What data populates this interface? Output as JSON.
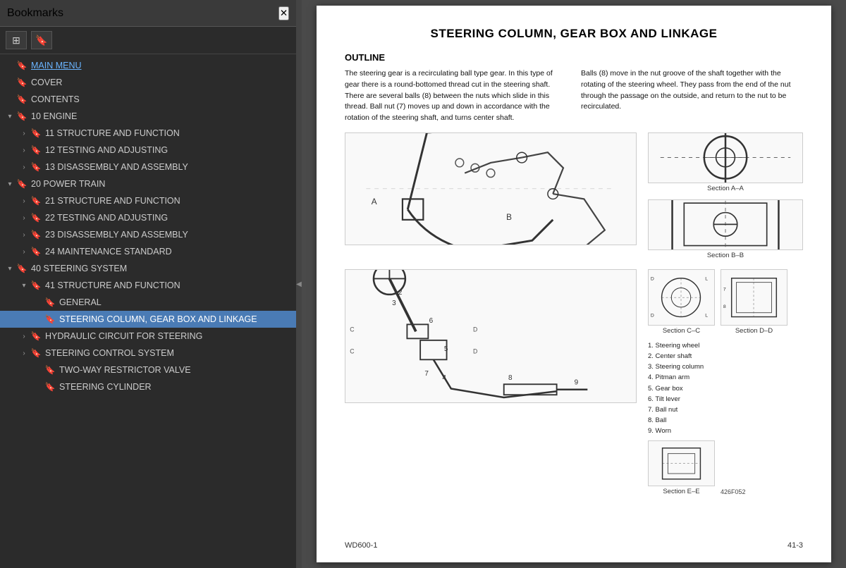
{
  "sidebar": {
    "title": "Bookmarks",
    "items": [
      {
        "id": "main-menu",
        "label": "MAIN MENU",
        "indent": 0,
        "type": "link",
        "expand": "none",
        "bookmark": true
      },
      {
        "id": "cover",
        "label": "COVER",
        "indent": 0,
        "type": "normal",
        "expand": "none",
        "bookmark": true
      },
      {
        "id": "contents",
        "label": "CONTENTS",
        "indent": 0,
        "type": "normal",
        "expand": "none",
        "bookmark": true
      },
      {
        "id": "10-engine",
        "label": "10 ENGINE",
        "indent": 0,
        "type": "normal",
        "expand": "open",
        "bookmark": true
      },
      {
        "id": "11-struct",
        "label": "11 STRUCTURE AND FUNCTION",
        "indent": 1,
        "type": "normal",
        "expand": "closed",
        "bookmark": true
      },
      {
        "id": "12-test",
        "label": "12 TESTING AND ADJUSTING",
        "indent": 1,
        "type": "normal",
        "expand": "closed",
        "bookmark": true
      },
      {
        "id": "13-disasm",
        "label": "13 DISASSEMBLY AND ASSEMBLY",
        "indent": 1,
        "type": "normal",
        "expand": "closed",
        "bookmark": true
      },
      {
        "id": "20-power",
        "label": "20 POWER TRAIN",
        "indent": 0,
        "type": "normal",
        "expand": "open",
        "bookmark": true
      },
      {
        "id": "21-struct",
        "label": "21 STRUCTURE AND FUNCTION",
        "indent": 1,
        "type": "normal",
        "expand": "closed",
        "bookmark": true
      },
      {
        "id": "22-test",
        "label": "22 TESTING AND ADJUSTING",
        "indent": 1,
        "type": "normal",
        "expand": "closed",
        "bookmark": true
      },
      {
        "id": "23-disasm",
        "label": "23 DISASSEMBLY AND ASSEMBLY",
        "indent": 1,
        "type": "normal",
        "expand": "closed",
        "bookmark": true
      },
      {
        "id": "24-maint",
        "label": "24 MAINTENANCE STANDARD",
        "indent": 1,
        "type": "normal",
        "expand": "closed",
        "bookmark": true
      },
      {
        "id": "40-steering",
        "label": "40 STEERING SYSTEM",
        "indent": 0,
        "type": "normal",
        "expand": "open",
        "bookmark": true
      },
      {
        "id": "41-struct",
        "label": "41 STRUCTURE AND FUNCTION",
        "indent": 1,
        "type": "normal",
        "expand": "open",
        "bookmark": true
      },
      {
        "id": "general",
        "label": "GENERAL",
        "indent": 2,
        "type": "normal",
        "expand": "none",
        "bookmark": true
      },
      {
        "id": "steering-col",
        "label": "STEERING COLUMN, GEAR BOX AND LINKAGE",
        "indent": 2,
        "type": "normal",
        "expand": "none",
        "bookmark": true,
        "selected": true
      },
      {
        "id": "hydraulic",
        "label": "HYDRAULIC CIRCUIT FOR STEERING",
        "indent": 1,
        "type": "normal",
        "expand": "closed",
        "bookmark": true
      },
      {
        "id": "steering-ctrl",
        "label": "STEERING CONTROL SYSTEM",
        "indent": 1,
        "type": "normal",
        "expand": "closed",
        "bookmark": true
      },
      {
        "id": "two-way",
        "label": "TWO-WAY RESTRICTOR VALVE",
        "indent": 2,
        "type": "normal",
        "expand": "none",
        "bookmark": true
      },
      {
        "id": "steering-cyl",
        "label": "STEERING CYLINDER",
        "indent": 2,
        "type": "normal",
        "expand": "none",
        "bookmark": true
      }
    ]
  },
  "document": {
    "page_title": "STEERING COLUMN, GEAR BOX AND LINKAGE",
    "outline_label": "OUTLINE",
    "col1_text": "The steering gear is a recirculating ball type gear. In this type of gear there is a round-bottomed thread cut in the steering shaft. There are several balls (8) between the nuts which slide in this thread. Ball nut (7) moves up and down in accordance with the rotation of the steering shaft, and turns center shaft.",
    "col2_text": "Balls (8) move in the nut groove of the shaft together with the rotating of the steering wheel. They pass from the end of the nut through the passage on the outside, and return to the nut to be recirculated.",
    "section_aa": "Section A–A",
    "section_bb": "Section B–B",
    "section_cc": "Section C–C",
    "section_dd": "Section D–D",
    "section_ee": "Section E–E",
    "parts_list": [
      "1.  Steering wheel",
      "2.  Center shaft",
      "3.  Steering column",
      "4.  Pitman arm",
      "5.  Gear box",
      "6.  Tilt lever",
      "7.  Ball nut",
      "8.  Ball",
      "9.  Worn"
    ],
    "parts_ref": "426F052",
    "footer_left": "WD600-1",
    "footer_right": "41-3"
  },
  "icons": {
    "expand_open": "▾",
    "expand_closed": "›",
    "bookmark": "🔖",
    "close": "✕",
    "grid_icon": "▦",
    "tag_icon": "🏷"
  }
}
